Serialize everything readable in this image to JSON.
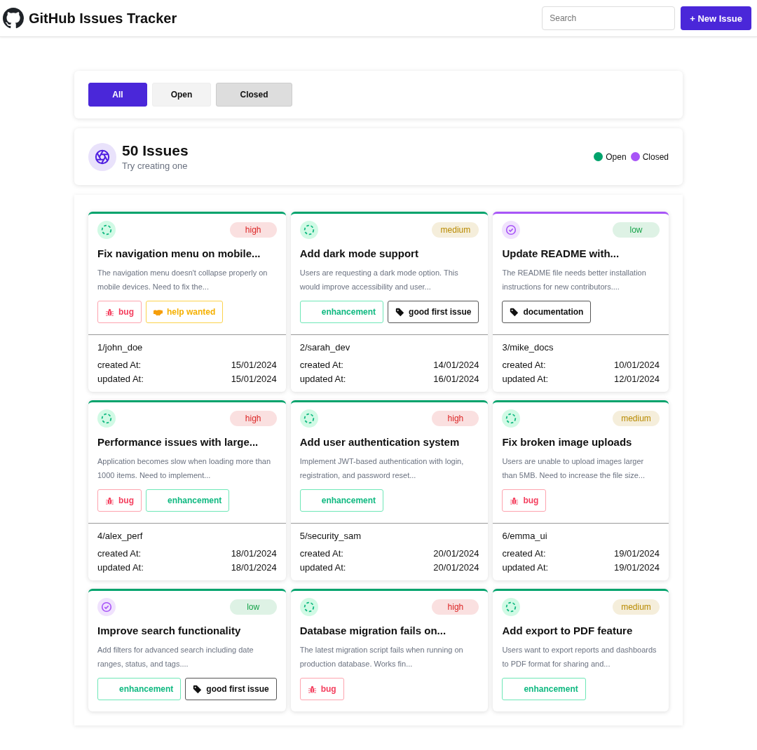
{
  "header": {
    "title": "GitHub Issues Tracker",
    "search": {
      "placeholder": "Search"
    },
    "new_button": "+ New Issue"
  },
  "filters": [
    {
      "label": "All",
      "selected": true,
      "hovered": false
    },
    {
      "label": "Open",
      "selected": false,
      "hovered": false
    },
    {
      "label": "Closed",
      "selected": false,
      "hovered": true
    }
  ],
  "summary": {
    "count": "50 Issues",
    "subtitle": "Try creating one",
    "legend": [
      {
        "label": "Open",
        "color": "#00a36c"
      },
      {
        "label": "Closed",
        "color": "#a855f7"
      }
    ]
  },
  "issues": [
    {
      "closed": false,
      "color": "#00a36c",
      "priority": {
        "text": "high",
        "color": "#dc2626"
      },
      "title": "Fix navigation menu on mobile...",
      "description": "The navigation menu doesn't collapse properly on mobile devices. Need to fix the...",
      "labels": [
        {
          "kind": "bug",
          "text": "bug"
        },
        {
          "kind": "help",
          "text": "help wanted"
        }
      ],
      "author": "1/john_doe",
      "created_label": "created At:",
      "created": "15/01/2024",
      "updated_label": "updated At:",
      "updated": "15/01/2024"
    },
    {
      "closed": false,
      "color": "#00a36c",
      "priority": {
        "text": "medium",
        "color": "#b88a00"
      },
      "title": "Add dark mode support",
      "description": "Users are requesting a dark mode option. This would improve accessibility and user...",
      "labels": [
        {
          "kind": "enhancement",
          "text": "enhancement"
        },
        {
          "kind": "tag",
          "text": "good first issue"
        }
      ],
      "author": "2/sarah_dev",
      "created_label": "created At:",
      "created": "14/01/2024",
      "updated_label": "updated At:",
      "updated": "16/01/2024"
    },
    {
      "closed": true,
      "color": "#a855f7",
      "priority": {
        "text": "low",
        "color": "#16a34a"
      },
      "title": "Update README with...",
      "description": "The README file needs better installation instructions for new contributors....",
      "labels": [
        {
          "kind": "tag",
          "text": "documentation"
        }
      ],
      "author": "3/mike_docs",
      "created_label": "created At:",
      "created": "10/01/2024",
      "updated_label": "updated At:",
      "updated": "12/01/2024"
    },
    {
      "closed": false,
      "color": "#00a36c",
      "priority": {
        "text": "high",
        "color": "#dc2626"
      },
      "title": "Performance issues with large...",
      "description": "Application becomes slow when loading more than 1000 items. Need to implement...",
      "labels": [
        {
          "kind": "bug",
          "text": "bug"
        },
        {
          "kind": "enhancement",
          "text": "enhancement"
        }
      ],
      "author": "4/alex_perf",
      "created_label": "created At:",
      "created": "18/01/2024",
      "updated_label": "updated At:",
      "updated": "18/01/2024"
    },
    {
      "closed": false,
      "color": "#00a36c",
      "priority": {
        "text": "high",
        "color": "#dc2626"
      },
      "title": "Add user authentication system",
      "description": "Implement JWT-based authentication with login, registration, and password reset...",
      "labels": [
        {
          "kind": "enhancement",
          "text": "enhancement"
        }
      ],
      "author": "5/security_sam",
      "created_label": "created At:",
      "created": "20/01/2024",
      "updated_label": "updated At:",
      "updated": "20/01/2024"
    },
    {
      "closed": false,
      "color": "#00a36c",
      "priority": {
        "text": "medium",
        "color": "#b88a00"
      },
      "title": "Fix broken image uploads",
      "description": "Users are unable to upload images larger than 5MB. Need to increase the file size...",
      "labels": [
        {
          "kind": "bug",
          "text": "bug"
        }
      ],
      "author": "6/emma_ui",
      "created_label": "created At:",
      "created": "19/01/2024",
      "updated_label": "updated At:",
      "updated": "19/01/2024"
    },
    {
      "closed": true,
      "color": "#00a36c",
      "priority": {
        "text": "low",
        "color": "#16a34a"
      },
      "title": "Improve search functionality",
      "description": "Add filters for advanced search including date ranges, status, and tags....",
      "labels": [
        {
          "kind": "enhancement",
          "text": "enhancement"
        },
        {
          "kind": "tag",
          "text": "good first issue"
        }
      ]
    },
    {
      "closed": false,
      "color": "#00a36c",
      "priority": {
        "text": "high",
        "color": "#dc2626"
      },
      "title": "Database migration fails on...",
      "description": "The latest migration script fails when running on production database. Works fin...",
      "labels": [
        {
          "kind": "bug",
          "text": "bug"
        }
      ]
    },
    {
      "closed": false,
      "color": "#00a36c",
      "priority": {
        "text": "medium",
        "color": "#b88a00"
      },
      "title": "Add export to PDF feature",
      "description": "Users want to export reports and dashboards to PDF format for sharing and...",
      "labels": [
        {
          "kind": "enhancement",
          "text": "enhancement"
        }
      ]
    }
  ]
}
